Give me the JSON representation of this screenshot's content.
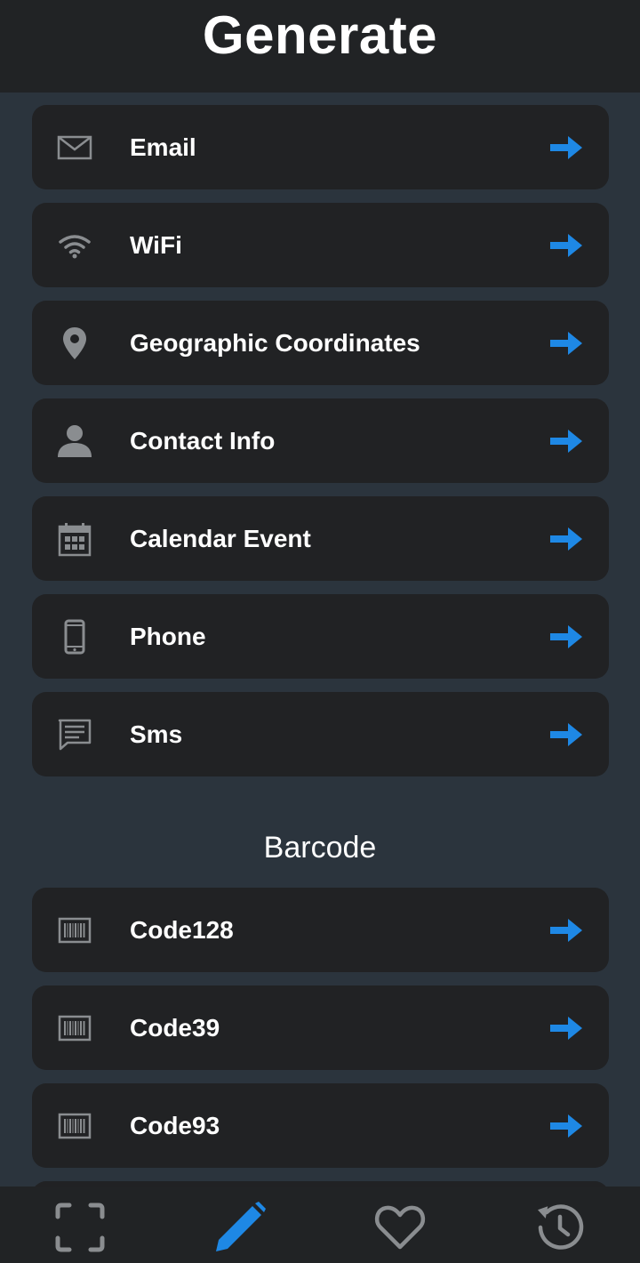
{
  "header": {
    "title": "Generate"
  },
  "qr_items": [
    {
      "label": "Email",
      "icon": "email-icon"
    },
    {
      "label": "WiFi",
      "icon": "wifi-icon"
    },
    {
      "label": "Geographic Coordinates",
      "icon": "location-pin-icon"
    },
    {
      "label": "Contact Info",
      "icon": "person-icon"
    },
    {
      "label": "Calendar Event",
      "icon": "calendar-icon"
    },
    {
      "label": "Phone",
      "icon": "phone-icon"
    },
    {
      "label": "Sms",
      "icon": "sms-icon"
    }
  ],
  "barcode_section": {
    "title": "Barcode",
    "items": [
      {
        "label": "Code128",
        "icon": "barcode-icon"
      },
      {
        "label": "Code39",
        "icon": "barcode-icon"
      },
      {
        "label": "Code93",
        "icon": "barcode-icon"
      }
    ]
  },
  "bottom_nav": [
    {
      "name": "scan",
      "icon": "scan-frame-icon",
      "active": false
    },
    {
      "name": "generate",
      "icon": "pencil-icon",
      "active": true
    },
    {
      "name": "favorites",
      "icon": "heart-icon",
      "active": false
    },
    {
      "name": "history",
      "icon": "history-icon",
      "active": false
    }
  ],
  "colors": {
    "background": "#2b343d",
    "card": "#212224",
    "header": "#212325",
    "accent": "#1e88e5",
    "icon_gray": "#8a8d90",
    "text": "#ffffff"
  }
}
